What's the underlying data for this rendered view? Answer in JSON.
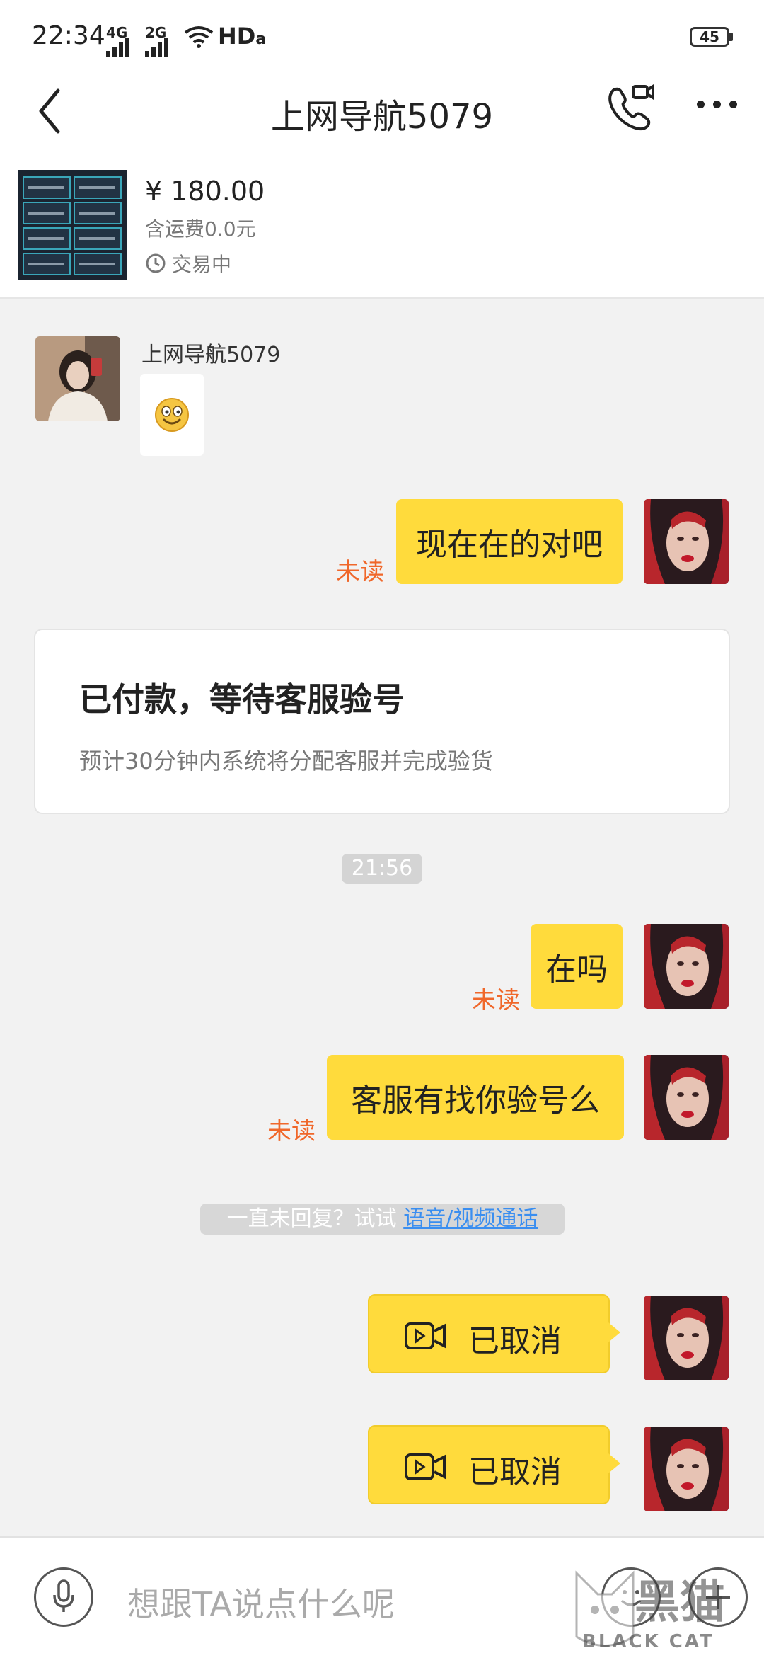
{
  "status_bar": {
    "time": "22:34",
    "signal_1": "4G",
    "signal_2": "2G",
    "network": "HD",
    "network_sub": "a",
    "battery": "45"
  },
  "nav": {
    "title": "上网导航5079"
  },
  "product": {
    "price": "¥ 180.00",
    "shipping": "含运费0.0元",
    "status": "交易中"
  },
  "messages": {
    "peer_name": "上网导航5079",
    "peer_emoji": "😊",
    "msg1": {
      "text": "现在在的对吧",
      "read_status": "未读"
    },
    "order_card": {
      "title": "已付款，等待客服验号",
      "subtitle": "预计30分钟内系统将分配客服并完成验货"
    },
    "timestamp": "21:56",
    "msg2": {
      "text": "在吗",
      "read_status": "未读"
    },
    "msg3": {
      "text": "客服有找你验号么",
      "read_status": "未读"
    },
    "hint": {
      "prefix": "一直未回复？试试 ",
      "link": "语音/视频通话"
    },
    "call1": {
      "text": "已取消"
    },
    "call2": {
      "text": "已取消"
    }
  },
  "input": {
    "placeholder": "想跟TA说点什么呢"
  },
  "watermark": {
    "brand_cn": "黑猫",
    "brand_en": "BLACK CAT"
  },
  "colors": {
    "bubble": "#ffdb3c",
    "unread": "#f0672a",
    "link": "#3a8ef0",
    "background": "#f2f2f2"
  }
}
